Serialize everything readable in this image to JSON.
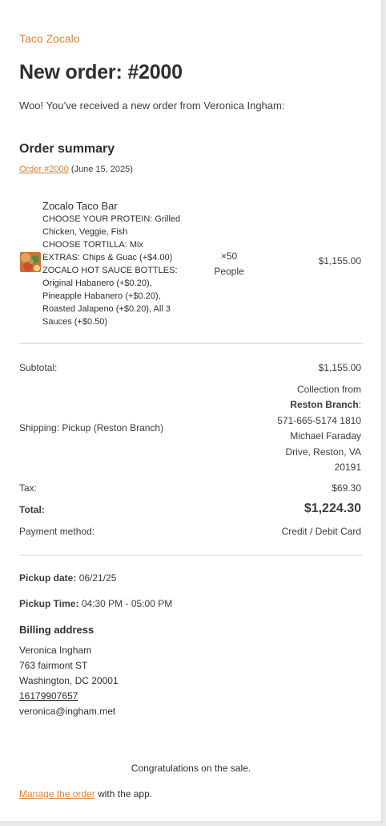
{
  "store_name": "Taco Zocalo",
  "heading": "New order: #2000",
  "intro": "Woo! You’ve received a new order from Veronica Ingham:",
  "summary": {
    "heading": "Order summary",
    "order_link": "Order #2000",
    "order_date": "(June 15, 2025)"
  },
  "item": {
    "name": "Zocalo Taco Bar",
    "meta_lines": [
      "CHOOSE YOUR PROTEIN: Grilled",
      "Chicken, Veggie, Fish",
      "CHOOSE TORTILLA: Mix",
      "EXTRAS: Chips & Guac (+$4.00)",
      "ZOCALO HOT SAUCE BOTTLES:",
      "Original Habanero (+$0.20),",
      "Pineapple Habanero (+$0.20),",
      "Roasted Jalapeno (+$0.20), All 3",
      "Sauces (+$0.50)"
    ],
    "qty": "×50",
    "qty_unit": "People",
    "price": "$1,155.00",
    "image_icon": "food-thumbnail-icon"
  },
  "totals": {
    "subtotal_label": "Subtotal:",
    "subtotal_value": "$1,155.00",
    "shipping_label": "Shipping: Pickup (Reston Branch)",
    "shipping_prefix": "Collection from",
    "shipping_branch": "Reston Branch",
    "shipping_rest_1": "571-665-5174 1810",
    "shipping_rest_2": "Michael Faraday",
    "shipping_rest_3": "Drive, Reston, VA",
    "shipping_rest_4": "20191",
    "tax_label": "Tax:",
    "tax_value": "$69.30",
    "total_label": "Total:",
    "total_value": "$1,224.30",
    "payment_label": "Payment method:",
    "payment_value": "Credit / Debit Card"
  },
  "pickup": {
    "date_label": "Pickup date:",
    "date_value": "06/21/25",
    "time_label": "Pickup Time:",
    "time_value": "04:30 PM - 05:00 PM"
  },
  "billing": {
    "heading": "Billing address",
    "name": "Veronica Ingham",
    "street": "763 fairmont ST",
    "city": "Washington, DC 20001",
    "phone": "16179907657",
    "email": "veronica@ingham.met"
  },
  "footer": {
    "congrats": "Congratulations on the sale.",
    "manage_link": "Manage the order",
    "manage_rest": " with the app."
  },
  "colors": {
    "accent": "#d9823b",
    "text": "#3c3c3c",
    "divider": "#d4d4d4"
  }
}
